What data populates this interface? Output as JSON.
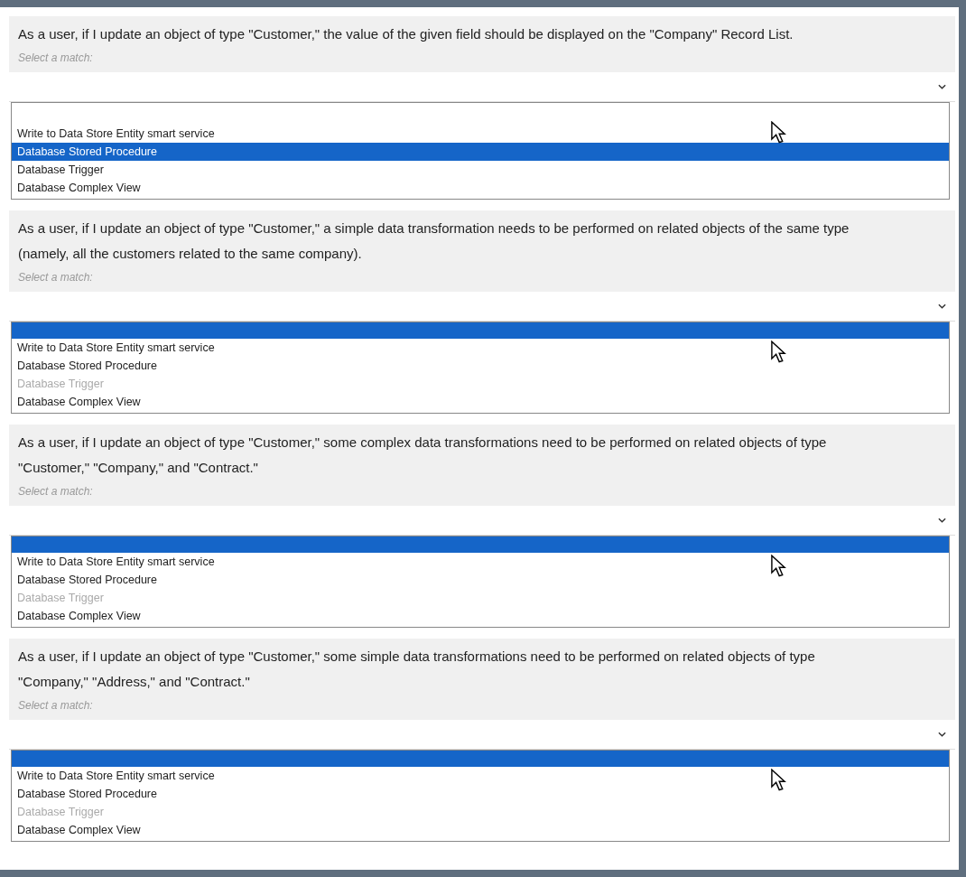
{
  "questions": [
    {
      "text": "As a user, if I update an object of type \"Customer,\" the value of the given field should be displayed on the \"Company\" Record List.",
      "prompt": "Select a match:",
      "options": [
        {
          "kind": "blank",
          "selected": false
        },
        {
          "kind": "option",
          "label": "Write to Data Store Entity smart service",
          "selected": false,
          "disabled": false
        },
        {
          "kind": "option",
          "label": "Database Stored Procedure",
          "selected": true,
          "disabled": false
        },
        {
          "kind": "option",
          "label": "Database Trigger",
          "selected": false,
          "disabled": false
        },
        {
          "kind": "option",
          "label": "Database Complex View",
          "selected": false,
          "disabled": false
        }
      ]
    },
    {
      "text": "As a user, if I update an object of type \"Customer,\" a simple data transformation needs to be performed on related objects of the same type (namely, all the customers related to the same company).",
      "prompt": "Select a match:",
      "options": [
        {
          "kind": "blank",
          "selected": true
        },
        {
          "kind": "option",
          "label": "Write to Data Store Entity smart service",
          "selected": false,
          "disabled": false
        },
        {
          "kind": "option",
          "label": "Database Stored Procedure",
          "selected": false,
          "disabled": false
        },
        {
          "kind": "option",
          "label": "Database Trigger",
          "selected": false,
          "disabled": true
        },
        {
          "kind": "option",
          "label": "Database Complex View",
          "selected": false,
          "disabled": false
        }
      ]
    },
    {
      "text": "As a user, if I update an object of type \"Customer,\" some complex data transformations need to be performed on related objects of type \"Customer,\" \"Company,\" and \"Contract.\"",
      "prompt": "Select a match:",
      "options": [
        {
          "kind": "blank",
          "selected": true
        },
        {
          "kind": "option",
          "label": "Write to Data Store Entity smart service",
          "selected": false,
          "disabled": false
        },
        {
          "kind": "option",
          "label": "Database Stored Procedure",
          "selected": false,
          "disabled": false
        },
        {
          "kind": "option",
          "label": "Database Trigger",
          "selected": false,
          "disabled": true
        },
        {
          "kind": "option",
          "label": "Database Complex View",
          "selected": false,
          "disabled": false
        }
      ]
    },
    {
      "text": "As a user, if I update an object of type \"Customer,\" some simple data transformations need to be performed on related objects of type \"Company,\" \"Address,\" and \"Contract.\"",
      "prompt": "Select a match:",
      "options": [
        {
          "kind": "blank",
          "selected": true
        },
        {
          "kind": "option",
          "label": "Write to Data Store Entity smart service",
          "selected": false,
          "disabled": false
        },
        {
          "kind": "option",
          "label": "Database Stored Procedure",
          "selected": false,
          "disabled": false
        },
        {
          "kind": "option",
          "label": "Database Trigger",
          "selected": false,
          "disabled": true
        },
        {
          "kind": "option",
          "label": "Database Complex View",
          "selected": false,
          "disabled": false
        }
      ]
    }
  ]
}
